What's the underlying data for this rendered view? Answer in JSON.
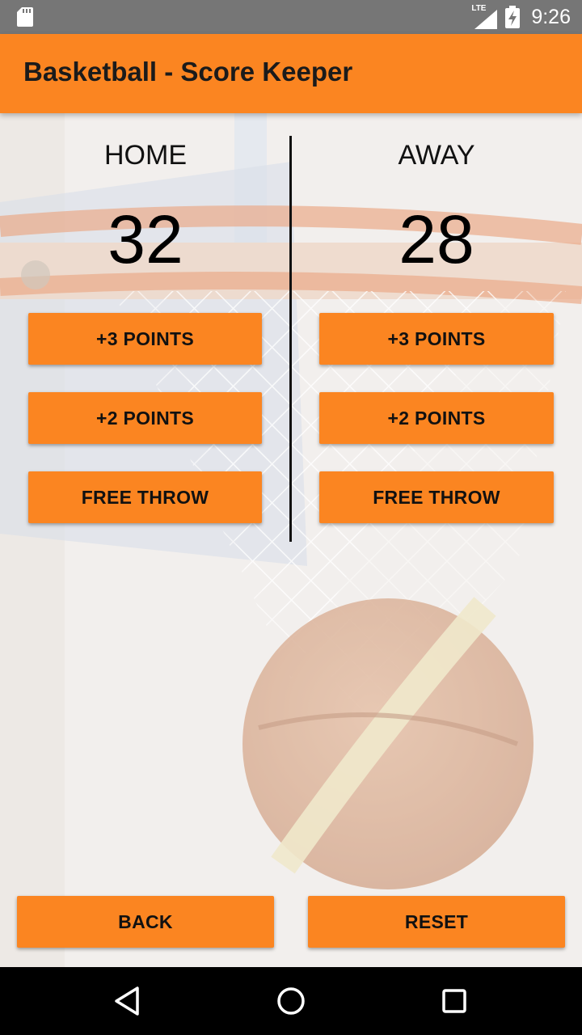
{
  "status_bar": {
    "time": "9:26",
    "network": "LTE",
    "icons": [
      "sd-card-icon",
      "lte-signal-icon",
      "battery-charging-icon"
    ]
  },
  "app_bar": {
    "title": "Basketball - Score Keeper"
  },
  "home": {
    "name": "HOME",
    "score": "32",
    "buttons": [
      "+3 POINTS",
      "+2 POINTS",
      "FREE THROW"
    ]
  },
  "away": {
    "name": "AWAY",
    "score": "28",
    "buttons": [
      "+3 POINTS",
      "+2 POINTS",
      "FREE THROW"
    ]
  },
  "footer": {
    "back_label": "BACK",
    "reset_label": "RESET"
  },
  "nav": {
    "icons": [
      "back-triangle-icon",
      "home-circle-icon",
      "recents-square-icon"
    ]
  },
  "colors": {
    "accent": "#fb8521",
    "status_bar": "#767676",
    "nav_bar": "#000000"
  }
}
